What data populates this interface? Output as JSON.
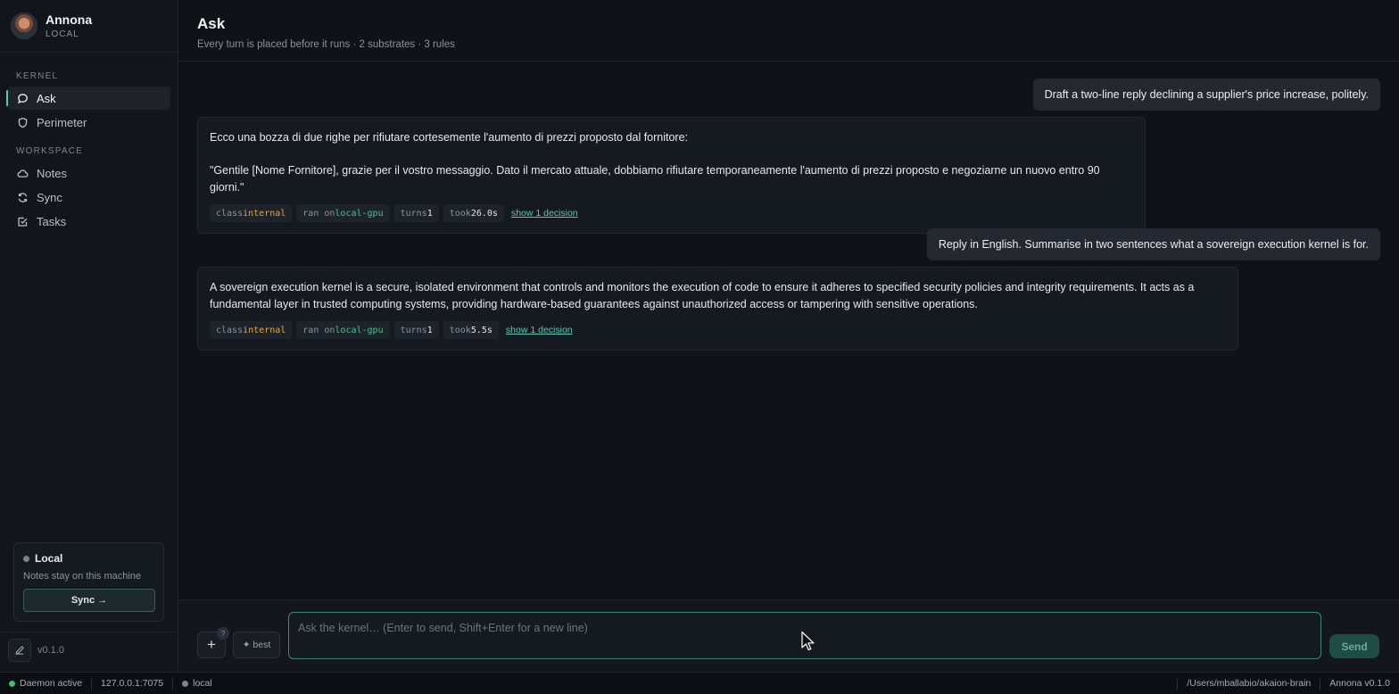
{
  "brand": {
    "name": "Annona",
    "subtitle": "LOCAL"
  },
  "sidebar": {
    "sections": [
      {
        "label": "KERNEL",
        "items": [
          {
            "label": "Ask",
            "icon": "chat-bubble-icon",
            "active": true
          },
          {
            "label": "Perimeter",
            "icon": "shield-icon"
          }
        ]
      },
      {
        "label": "WORKSPACE",
        "items": [
          {
            "label": "Notes",
            "icon": "cloud-icon"
          },
          {
            "label": "Sync",
            "icon": "refresh-icon"
          },
          {
            "label": "Tasks",
            "icon": "checkbox-icon"
          }
        ]
      }
    ],
    "local_card": {
      "title": "Local",
      "description": "Notes stay on this machine",
      "button": "Sync →"
    },
    "version": "v0.1.0"
  },
  "header": {
    "title": "Ask",
    "subtitle": "Every turn is placed before it runs · 2 substrates · 3 rules"
  },
  "conversation": {
    "m1": {
      "text": "Draft a two-line reply declining a supplier's price increase, politely."
    },
    "m2": {
      "lines": [
        "Ecco una bozza di due righe per rifiutare cortesemente l'aumento di prezzi proposto dal fornitore:",
        "\"Gentile [Nome Fornitore], grazie per il vostro messaggio. Dato il mercato attuale, dobbiamo rifiutare temporaneamente l'aumento di prezzi proposto e negoziarne un nuovo entro 90 giorni.\""
      ],
      "meta": {
        "class_label": "class",
        "class_value": "internal",
        "ran_label": "ran on",
        "ran_value": "local-gpu",
        "turns_label": "turns",
        "turns_value": "1",
        "took_label": "took",
        "took_value": "26.0s"
      },
      "decision_link": "show 1 decision"
    },
    "m3": {
      "text": "Reply in English. Summarise in two sentences what a sovereign execution kernel is for."
    },
    "m4": {
      "lines": [
        "A sovereign execution kernel is a secure, isolated environment that controls and monitors the execution of code to ensure it adheres to specified security policies and integrity requirements. It acts as a fundamental layer in trusted computing systems, providing hardware-based guarantees against unauthorized access or tampering with sensitive operations."
      ],
      "meta": {
        "class_label": "class",
        "class_value": "internal",
        "ran_label": "ran on",
        "ran_value": "local-gpu",
        "turns_label": "turns",
        "turns_value": "1",
        "took_label": "took",
        "took_value": "5.5s"
      },
      "decision_link": "show 1 decision"
    }
  },
  "composer": {
    "plus_label": "+",
    "plus_badge": "?",
    "best_label": "✦ best",
    "placeholder": "Ask the kernel… (Enter to send, Shift+Enter for a new line)",
    "send_label": "Send"
  },
  "statusbar": {
    "daemon": "Daemon active",
    "address": "127.0.0.1:7075",
    "mode": "local",
    "path": "/Users/mballabio/akaion-brain",
    "app_version": "Annona v0.1.0"
  },
  "colors": {
    "accent": "#5fc7b4",
    "daemon_green": "#3fbf6f",
    "class_internal": "#e0a93a",
    "ran_local_gpu": "#4fc08d"
  }
}
